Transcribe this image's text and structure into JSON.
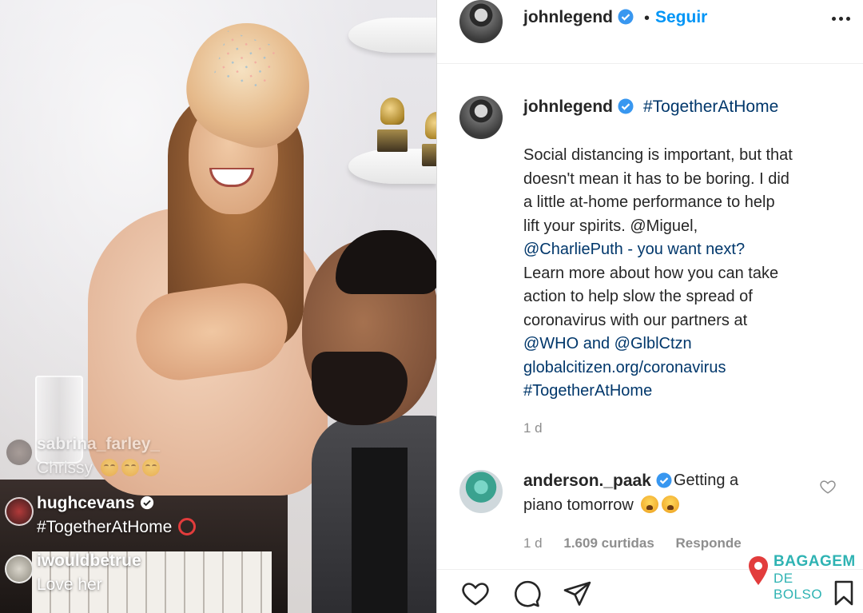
{
  "post": {
    "username": "johnlegend",
    "follow_label": "Seguir",
    "caption_tag": "#TogetherAtHome",
    "caption_lines": [
      "Social distancing is important, but that",
      "doesn't mean it has to be boring. I did",
      "a little at-home performance to help",
      "lift your spirits. @Miguel,",
      "@CharliePuth - you want next?",
      "Learn more about how you can take",
      "action to help slow the spread of",
      "coronavirus with our partners at",
      "@WHO and @GlblCtzn",
      "globalcitizen.org/coronavirus",
      "#TogetherAtHome"
    ],
    "caption_time": "1 d"
  },
  "comment": {
    "username": "anderson._paak",
    "text_line1": "Getting a",
    "text_line2": "piano tomorrow",
    "time": "1 d",
    "likes": "1.609 curtidas",
    "reply": "Responde"
  },
  "live_comments": [
    {
      "user": "sabrina_farley_",
      "text": "Chrissy"
    },
    {
      "user": "hughcevans",
      "text": "#TogetherAtHome"
    },
    {
      "user": "iwouldbetrue",
      "text": "Love her"
    }
  ],
  "watermark": {
    "line1": "BAGAGEM",
    "line2": "DE BOLSO"
  },
  "icons": [
    "verified-badge-icon",
    "more-options-icon",
    "heart-icon",
    "comment-icon",
    "share-icon",
    "bookmark-icon",
    "location-pin-icon"
  ],
  "colors": {
    "link": "#00376b",
    "follow": "#0095f6",
    "verified": "#3897f0",
    "muted": "#8e8e8e",
    "watermark": "#2fb3b3"
  }
}
